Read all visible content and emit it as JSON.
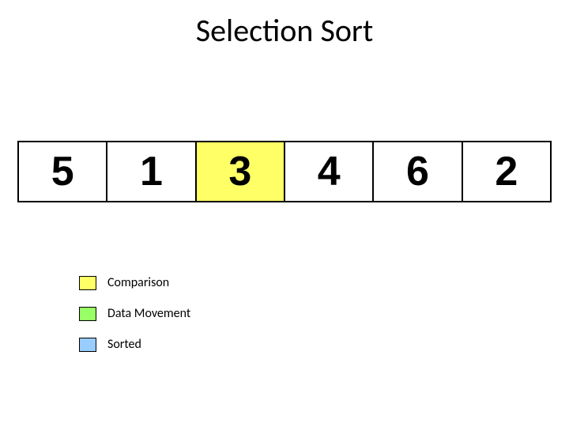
{
  "title": "Selection Sort",
  "colors": {
    "comparison": "#FFFF66",
    "data_movement": "#99FF66",
    "sorted": "#99CCFF",
    "none": "#FFFFFF"
  },
  "array": [
    {
      "value": "5",
      "state": "none"
    },
    {
      "value": "1",
      "state": "none"
    },
    {
      "value": "3",
      "state": "comparison"
    },
    {
      "value": "4",
      "state": "none"
    },
    {
      "value": "6",
      "state": "none"
    },
    {
      "value": "2",
      "state": "none"
    }
  ],
  "legend": [
    {
      "label": "Comparison",
      "color_key": "comparison"
    },
    {
      "label": "Data Movement",
      "color_key": "data_movement"
    },
    {
      "label": "Sorted",
      "color_key": "sorted"
    }
  ]
}
